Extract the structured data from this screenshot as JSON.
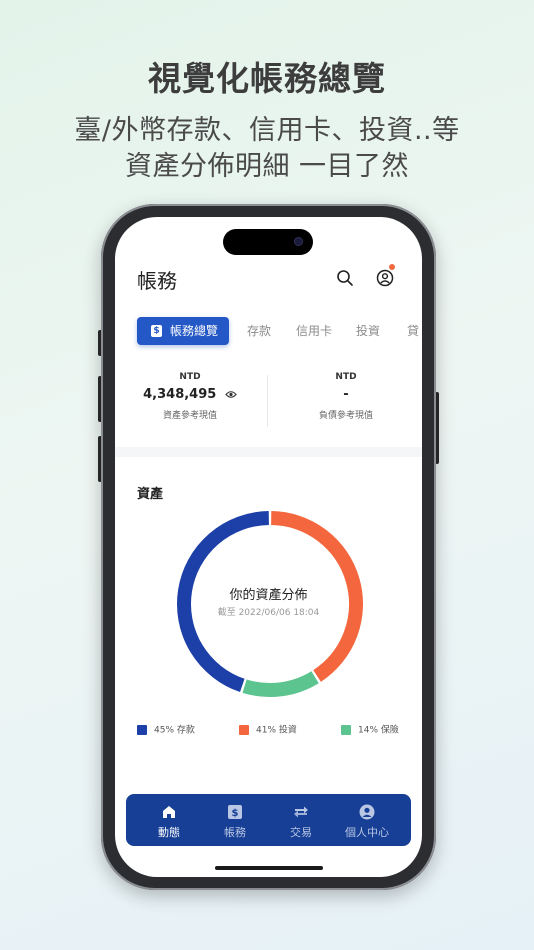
{
  "promo": {
    "headline": "視覺化帳務總覽",
    "subline1": "臺/外幣存款、信用卡、投資..等",
    "subline2": "資產分佈明細 一目了然"
  },
  "app": {
    "title": "帳務",
    "icons": {
      "search": "search-icon",
      "profile": "profile-icon"
    },
    "tabs": [
      {
        "label": "帳務總覽",
        "active": true,
        "icon": "dollar-icon"
      },
      {
        "label": "存款"
      },
      {
        "label": "信用卡"
      },
      {
        "label": "投資"
      },
      {
        "label": "貸"
      }
    ],
    "summary": {
      "assets": {
        "currency": "NTD",
        "value": "4,348,495",
        "label": "資產參考現值"
      },
      "liabilities": {
        "currency": "NTD",
        "value": "-",
        "label": "負債參考現值"
      }
    },
    "assets_section": {
      "title": "資產",
      "center_title": "你的資產分佈",
      "center_sub": "截至 2022/06/06 18:04"
    },
    "legend": [
      {
        "pct": "45%",
        "label": "存款",
        "color": "#1c3fa8"
      },
      {
        "pct": "41%",
        "label": "投資",
        "color": "#f4673e"
      },
      {
        "pct": "14%",
        "label": "保險",
        "color": "#5cc48e"
      }
    ],
    "tabbar": [
      {
        "label": "動態",
        "icon": "home-icon",
        "active": true
      },
      {
        "label": "帳務",
        "icon": "dollar-icon"
      },
      {
        "label": "交易",
        "icon": "transfer-icon"
      },
      {
        "label": "個人中心",
        "icon": "user-icon"
      }
    ]
  },
  "chart_data": {
    "type": "pie",
    "categories": [
      "存款",
      "投資",
      "保險"
    ],
    "values": [
      45,
      41,
      14
    ],
    "colors": [
      "#1c3fa8",
      "#f4673e",
      "#5cc48e"
    ],
    "title": "你的資產分佈"
  }
}
